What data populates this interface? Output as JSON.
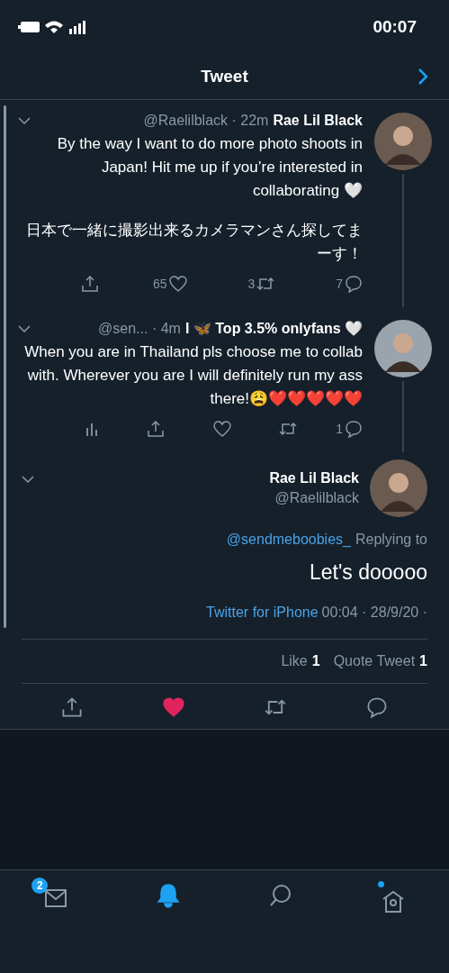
{
  "status_bar": {
    "time": "00:07"
  },
  "header": {
    "title": "Tweet"
  },
  "thread": [
    {
      "name": "Rae Lil Black",
      "meta": "@Raelilblack · 22m",
      "paragraphs": [
        "By the way I want to do more photo shoots in Japan! Hit me up if you’re interested in collaborating 🤍",
        "日本で一緒に撮影出来るカメラマンさん探してまーす！"
      ],
      "actions": [
        {
          "kind": "share"
        },
        {
          "kind": "like",
          "count": "65"
        },
        {
          "kind": "retweet",
          "count": "3"
        },
        {
          "kind": "reply",
          "count": "7"
        }
      ]
    },
    {
      "name": "I 🦋 Top 3.5% onlyfans 🤍",
      "meta": "@sen... · 4m",
      "paragraphs": [
        "When you are in Thailand pls choose me to collab with. Wherever you are I will definitely run my ass there!😩❤️❤️❤️❤️❤️"
      ],
      "actions": [
        {
          "kind": "analytics"
        },
        {
          "kind": "share"
        },
        {
          "kind": "like"
        },
        {
          "kind": "retweet"
        },
        {
          "kind": "reply",
          "count": "1"
        }
      ]
    }
  ],
  "main_tweet": {
    "name": "Rae Lil Black",
    "handle": "@Raelilblack",
    "replying_handle": "@sendmeboobies_",
    "replying_label": "Replying to",
    "text": "Let's dooooo",
    "source": "Twitter for iPhone",
    "time": "00:04 · 28/9/20 · ",
    "stats": [
      {
        "label": "Like",
        "count": "1"
      },
      {
        "label": "Quote Tweet",
        "count": "1"
      }
    ],
    "liked": true
  },
  "tab_bar": [
    {
      "kind": "messages",
      "selected": false,
      "badge": "2"
    },
    {
      "kind": "notifications",
      "selected": true
    },
    {
      "kind": "search",
      "selected": false
    },
    {
      "kind": "home",
      "selected": false,
      "unread": true
    }
  ]
}
